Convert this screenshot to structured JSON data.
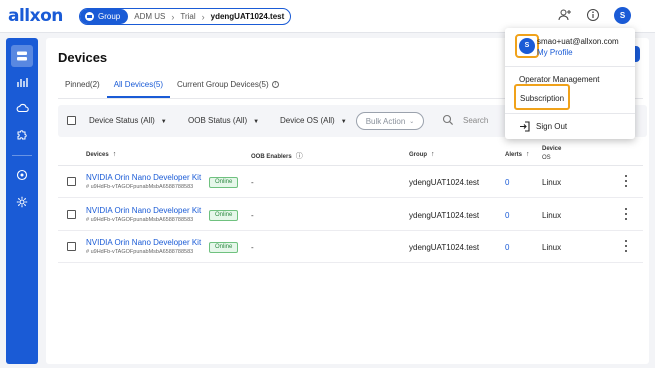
{
  "brand": {
    "logo_text": "allxon",
    "accent": "#1a5bd6",
    "highlight": "#f0a21a"
  },
  "breadcrumb": {
    "group_label": "Group",
    "items": [
      "ADM US",
      "Trial"
    ],
    "current": "ydengUAT1024.test"
  },
  "topbar": {
    "icons": [
      "add-user-icon",
      "info-icon"
    ],
    "avatar_letter": "S"
  },
  "sidebar": {
    "icons": [
      "devices-icon",
      "chart-icon",
      "cloud-icon",
      "plugin-icon",
      "settings-circle-icon",
      "gear-icon"
    ]
  },
  "page": {
    "title": "Devices",
    "tabs": [
      {
        "label": "Pinned(2)",
        "active": false
      },
      {
        "label": "All Devices(5)",
        "active": true
      },
      {
        "label": "Current Group Devices(5)",
        "active": false
      }
    ]
  },
  "filters": {
    "device_status": "Device Status (All)",
    "oob_status": "OOB Status (All)",
    "device_os": "Device OS (All)",
    "bulk_action": "Bulk Action",
    "search_placeholder": "Search"
  },
  "table": {
    "headers": {
      "devices": "Devices",
      "oob": "OOB Enablers",
      "group": "Group",
      "alerts": "Alerts",
      "device_os_line1": "Device",
      "device_os_line2": "OS"
    },
    "rows": [
      {
        "name": "NVIDIA Orin Nano Developer Kit",
        "id": "# u9HdFb-vTAGOFpunabMsbA6588788583",
        "status": "Online",
        "oob": "-",
        "group": "ydengUAT1024.test",
        "alerts": "0",
        "os": "Linux"
      },
      {
        "name": "NVIDIA Orin Nano Developer Kit",
        "id": "# u9HdFb-vTAGOFpunabMsbA6588788583",
        "status": "Online",
        "oob": "-",
        "group": "ydengUAT1024.test",
        "alerts": "0",
        "os": "Linux"
      },
      {
        "name": "NVIDIA Orin Nano Developer Kit",
        "id": "# u9HdFb-vTAGOFpunabMsbA6588788583",
        "status": "Online",
        "oob": "-",
        "group": "ydengUAT1024.test",
        "alerts": "0",
        "os": "Linux"
      }
    ]
  },
  "user_menu": {
    "avatar_letter": "S",
    "email": "smao+uat@allxon.com",
    "my_profile": "My Profile",
    "operator_management": "Operator Management",
    "subscription": "Subscription",
    "sign_out": "Sign Out"
  }
}
